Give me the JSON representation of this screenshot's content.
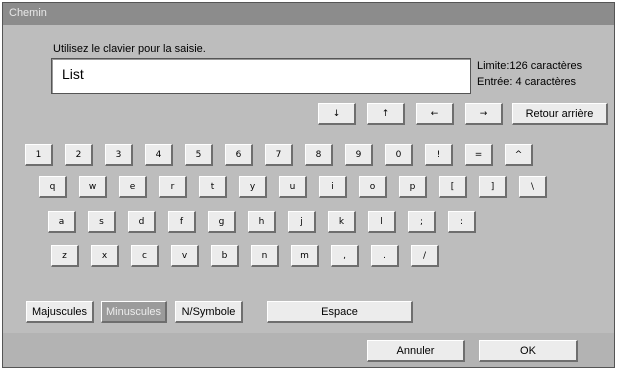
{
  "window": {
    "title": "Chemin"
  },
  "instruction": "Utilisez le clavier pour la saisie.",
  "input": {
    "value": "List"
  },
  "limits": {
    "limit_text": "Limite:126 caractères",
    "entry_text": "Entrée: 4 caractères"
  },
  "nav": {
    "down": "↓",
    "up": "↑",
    "left": "←",
    "right": "→",
    "backspace": "Retour arrière"
  },
  "rows": [
    [
      "1",
      "2",
      "3",
      "4",
      "5",
      "6",
      "7",
      "8",
      "9",
      "0",
      "!",
      "=",
      "^"
    ],
    [
      "q",
      "w",
      "e",
      "r",
      "t",
      "y",
      "u",
      "i",
      "o",
      "p",
      "[",
      "]",
      "\\"
    ],
    [
      "a",
      "s",
      "d",
      "f",
      "g",
      "h",
      "j",
      "k",
      "l",
      ";",
      ":"
    ],
    [
      "z",
      "x",
      "c",
      "v",
      "b",
      "n",
      "m",
      ",",
      ".",
      "/"
    ]
  ],
  "modes": {
    "upper": "Majuscules",
    "lower": "Minuscules",
    "symbol": "N/Symbole"
  },
  "space": "Espace",
  "actions": {
    "cancel": "Annuler",
    "ok": "OK"
  }
}
